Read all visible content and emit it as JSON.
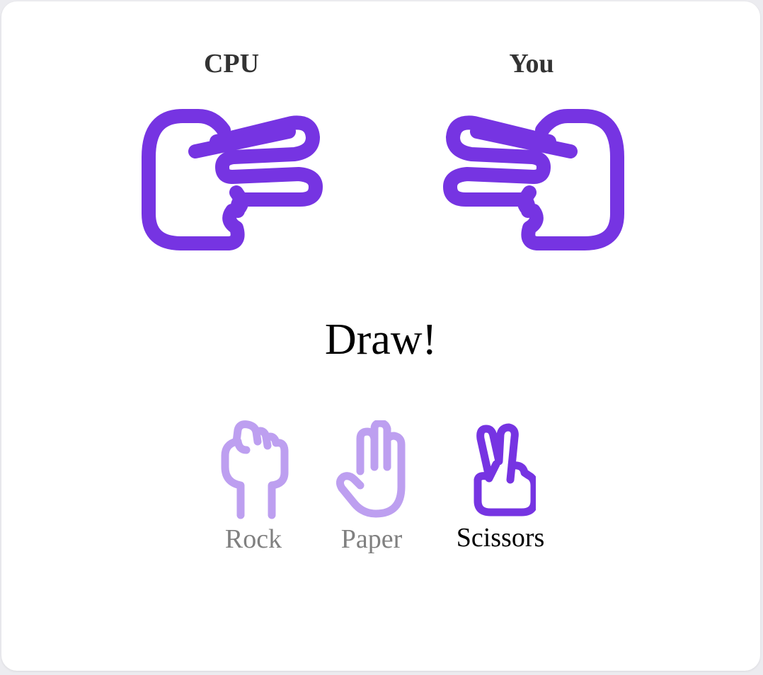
{
  "players": {
    "cpu_label": "CPU",
    "you_label": "You",
    "cpu_choice": "scissors-hand-icon",
    "you_choice": "scissors-hand-icon"
  },
  "result": "Draw!",
  "choices": [
    {
      "label": "Rock",
      "icon": "rock-fist-icon",
      "selected": false
    },
    {
      "label": "Paper",
      "icon": "paper-hand-icon",
      "selected": false
    },
    {
      "label": "Scissors",
      "icon": "scissors-hand-icon",
      "selected": true
    }
  ],
  "colors": {
    "accent": "#7634e2",
    "accent_light": "#bd9ff0",
    "label_dim": "#808080",
    "heading": "#333333",
    "background": "#ffffff"
  }
}
